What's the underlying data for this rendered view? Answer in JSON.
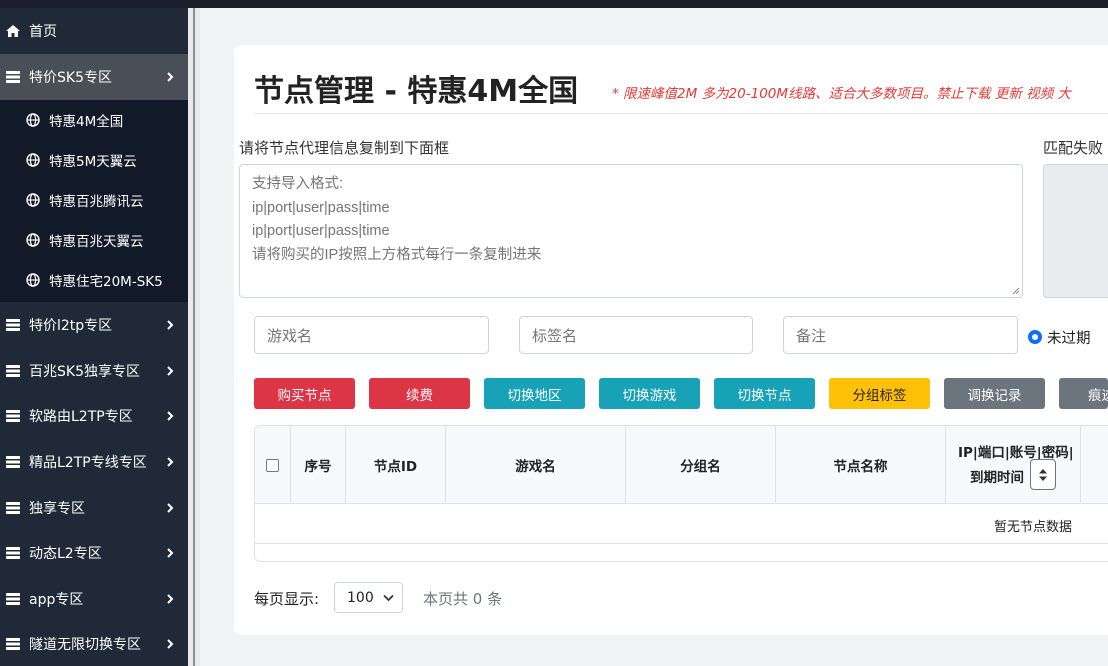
{
  "sidebar": {
    "items": [
      {
        "label": "首页",
        "icon": "home-icon",
        "has_arrow": false
      },
      {
        "label": "特价SK5专区",
        "icon": "list-icon",
        "has_arrow": true,
        "active": true
      },
      {
        "label": "特价l2tp专区",
        "icon": "list-icon",
        "has_arrow": true
      },
      {
        "label": "百兆SK5独享专区",
        "icon": "list-icon",
        "has_arrow": true
      },
      {
        "label": "软路由L2TP专区",
        "icon": "list-icon",
        "has_arrow": true
      },
      {
        "label": "精品L2TP专线专区",
        "icon": "list-icon",
        "has_arrow": true
      },
      {
        "label": "独享专区",
        "icon": "list-icon",
        "has_arrow": true
      },
      {
        "label": "动态L2专区",
        "icon": "list-icon",
        "has_arrow": true
      },
      {
        "label": "app专区",
        "icon": "list-icon",
        "has_arrow": true
      },
      {
        "label": "隧道无限切换专区",
        "icon": "list-icon",
        "has_arrow": true
      }
    ],
    "submenu": [
      {
        "label": "特惠4M全国",
        "icon": "globe-icon"
      },
      {
        "label": "特惠5M天翼云",
        "icon": "globe-icon"
      },
      {
        "label": "特惠百兆腾讯云",
        "icon": "globe-icon"
      },
      {
        "label": "特惠百兆天翼云",
        "icon": "globe-icon"
      },
      {
        "label": "特惠住宅20M-SK5",
        "icon": "globe-icon"
      }
    ]
  },
  "page": {
    "title": "节点管理 - 特惠4M全国",
    "notice": "* 限速峰值2M 多为20-100M线路、适合大多数项目。禁止下载 更新 视频 大"
  },
  "import": {
    "label": "请将节点代理信息复制到下面框",
    "placeholder": "支持导入格式:\nip|port|user|pass|time\nip|port|user|pass|time\n请将购买的IP按照上方格式每行一条复制进来",
    "fail_label": "匹配失败"
  },
  "filters": {
    "game_placeholder": "游戏名",
    "tag_placeholder": "标签名",
    "note_placeholder": "备注",
    "status_label": "未过期"
  },
  "buttons": {
    "buy": "购买节点",
    "renew": "续费",
    "switch_region": "切换地区",
    "switch_game": "切换游戏",
    "switch_node": "切换节点",
    "group_tag": "分组标签",
    "swap_log": "调换记录",
    "cut": "痕迹"
  },
  "table": {
    "headers": [
      "序号",
      "节点ID",
      "游戏名",
      "分组名",
      "节点名称"
    ],
    "ip_header_line1": "IP|端口|账号|密码|",
    "ip_header_line2": "到期时间",
    "empty": "暂无节点数据"
  },
  "pager": {
    "label": "每页显示:",
    "page_size": "100",
    "total": "本页共 0 条"
  },
  "colors": {
    "sidebar_bg": "#1f2937",
    "danger": "#dc3545",
    "info": "#17a2b8",
    "warning": "#ffc107",
    "secondary": "#6c757d",
    "notice_text": "#e53935"
  }
}
